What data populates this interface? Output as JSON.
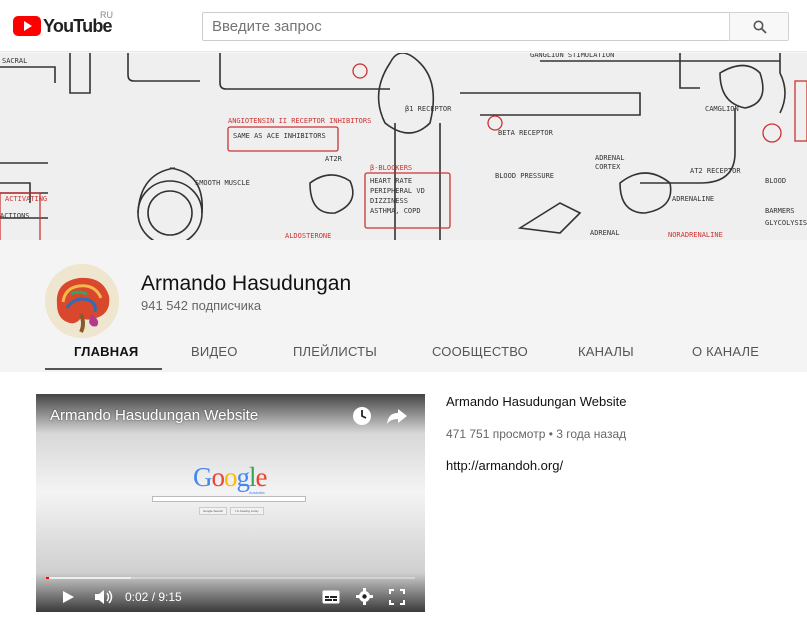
{
  "header": {
    "logo_text": "YouTube",
    "region": "RU",
    "search_placeholder": "Введите запрос",
    "brand_color": "#ff0000"
  },
  "banner": {
    "labels": [
      "SACRAL",
      "GANGLION",
      "CAMGLION",
      "ANGIOTENSIN II RECEPTOR INHIBITORS",
      "SAME AS ACE INHIBITORS",
      "AT2R",
      "β-BLOCKERS",
      "HEART RATE",
      "PERIPHERAL VD",
      "DIZZINESS",
      "ASTHMA, COPD",
      "SMOOTH MUSCLE",
      "β1 RECEPTOR",
      "BETA RECEPTOR",
      "BLOOD PRESSURE",
      "ADRENAL CORTEX",
      "AT2 RECEPTOR",
      "ADRENALINE",
      "ADRENAL"
    ]
  },
  "channel": {
    "name": "Armando Hasudungan",
    "subscribers": "941 542 подписчика"
  },
  "tabs": [
    {
      "label": "ГЛАВНАЯ",
      "active": true
    },
    {
      "label": "ВИДЕО",
      "active": false
    },
    {
      "label": "ПЛЕЙЛИСТЫ",
      "active": false
    },
    {
      "label": "СООБЩЕСТВО",
      "active": false
    },
    {
      "label": "КАНАЛЫ",
      "active": false
    },
    {
      "label": "О КАНАЛЕ",
      "active": false
    }
  ],
  "featured_video": {
    "player_title": "Armando Hasudungan Website",
    "google_logo": "Google",
    "google_region": "Australia",
    "google_search_button": "Google Search",
    "feeling_lucky_button": "I'm Feeling Lucky",
    "current_time": "0:02",
    "duration": "9:15",
    "progress": 0.004,
    "title": "Armando Hasudungan Website",
    "views": "471 751 просмотр",
    "age": "3 года назад",
    "description": "http://armandoh.org/"
  }
}
